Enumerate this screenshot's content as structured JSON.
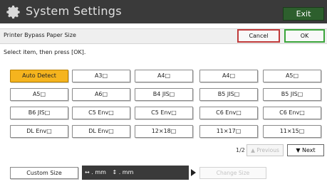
{
  "app": {
    "title": "System Settings",
    "exit_label": "Exit"
  },
  "header": {
    "page_title": "Printer Bypass Paper Size",
    "cancel_label": "Cancel",
    "ok_label": "OK"
  },
  "instruction": "Select item, then press [OK].",
  "paper_sizes": [
    {
      "label": "Auto Detect",
      "selected": true
    },
    {
      "label": "A3□"
    },
    {
      "label": "A4□"
    },
    {
      "label": "A4□"
    },
    {
      "label": "A5□"
    },
    {
      "label": "A5□"
    },
    {
      "label": "A6□"
    },
    {
      "label": "B4 JIS□"
    },
    {
      "label": "B5 JIS□"
    },
    {
      "label": "B5 JIS□"
    },
    {
      "label": "B6 JIS□"
    },
    {
      "label": "C5 Env□"
    },
    {
      "label": "C5 Env□"
    },
    {
      "label": "C6 Env□"
    },
    {
      "label": "C6 Env□"
    },
    {
      "label": "DL Env□"
    },
    {
      "label": "DL Env□"
    },
    {
      "label": "12×18□"
    },
    {
      "label": "11×17□"
    },
    {
      "label": "11×15□"
    }
  ],
  "pagination": {
    "indicator": "1/2",
    "previous_label": "▲ Previous",
    "next_label": "▼ Next"
  },
  "custom": {
    "button_label": "Custom Size",
    "width_text": "↔ . mm",
    "height_text": "↕ . mm",
    "change_label": "Change Size"
  }
}
